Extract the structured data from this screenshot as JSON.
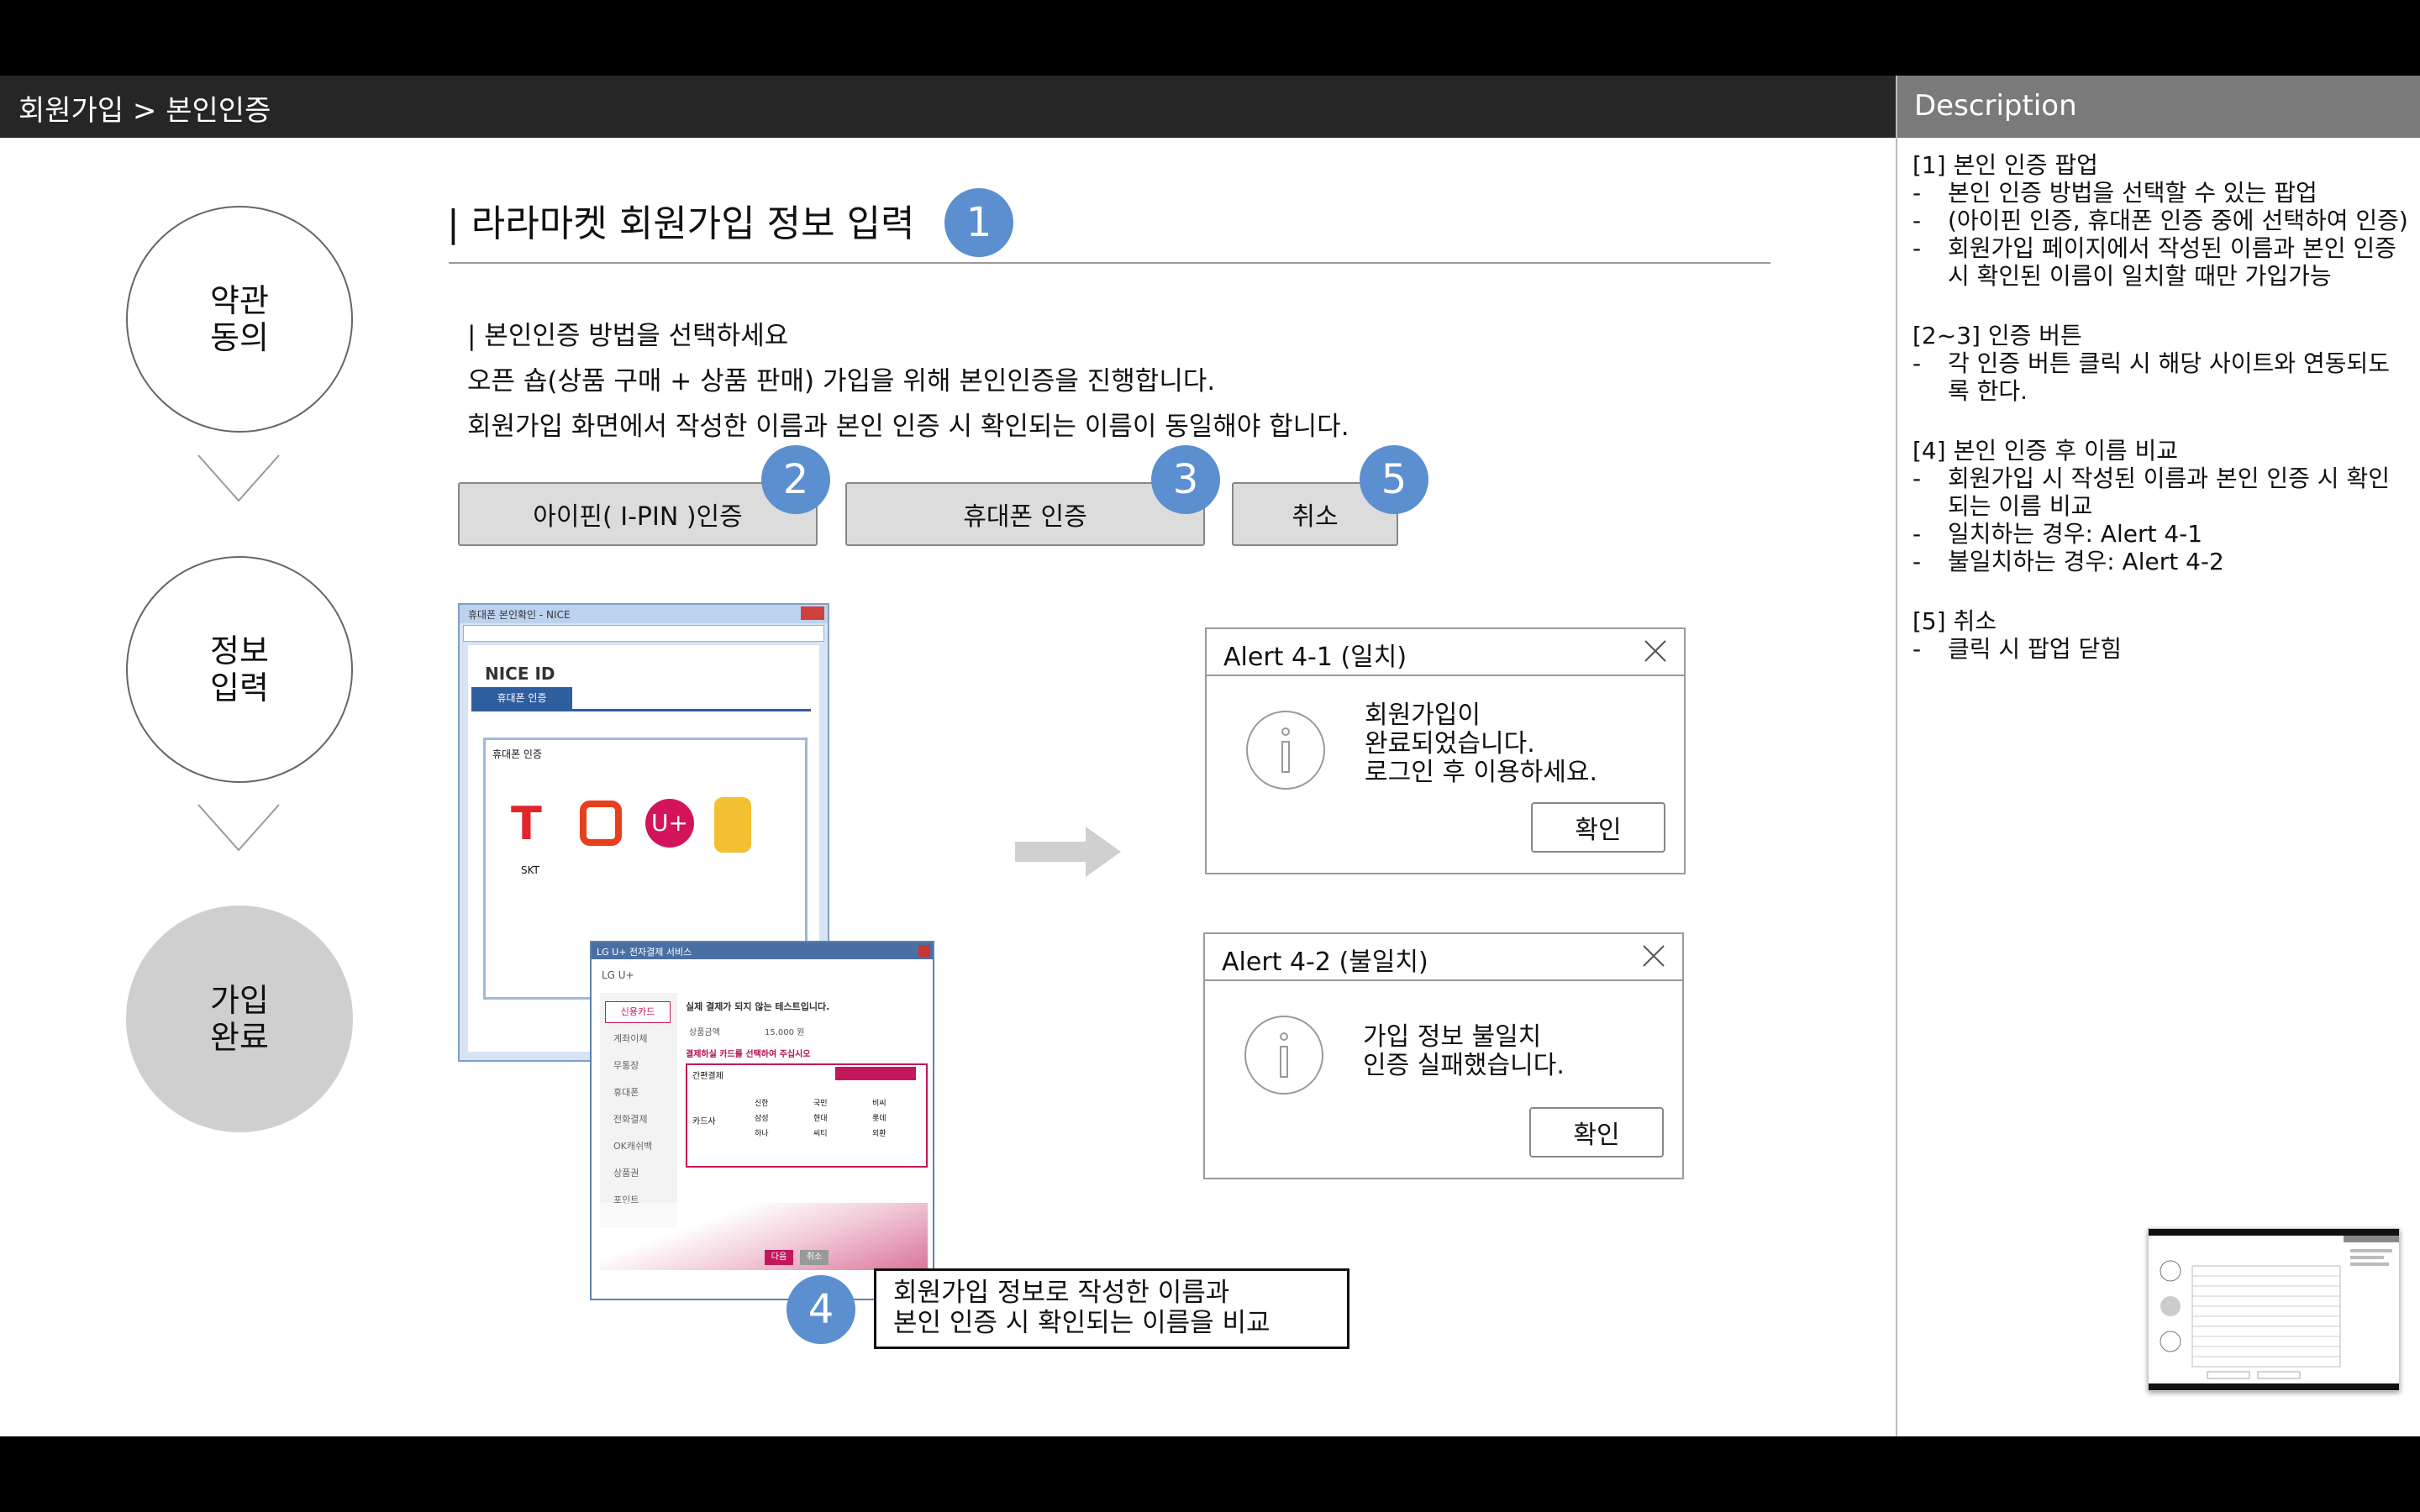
{
  "header": {
    "breadcrumb": "회원가입 > 본인인증"
  },
  "description": {
    "title": "Description",
    "sections": [
      {
        "heading": "[1] 본인 인증 팝업",
        "items": [
          "본인 인증 방법을 선택할 수 있는 팝업",
          "(아이핀 인증, 휴대폰 인증 중에 선택하여 인증)",
          "회원가입 페이지에서 작성된 이름과 본인 인증 시 확인된 이름이 일치할 때만 가입가능"
        ]
      },
      {
        "heading": "[2~3] 인증 버튼",
        "items": [
          "각 인증 버튼 클릭 시 해당 사이트와 연동되도록 한다."
        ]
      },
      {
        "heading": "[4] 본인 인증 후 이름 비교",
        "items": [
          "회원가입 시 작성된 이름과 본인 인증 시 확인되는 이름 비교",
          "일치하는 경우: Alert 4-1",
          "불일치하는 경우: Alert 4-2"
        ]
      },
      {
        "heading": "[5] 취소",
        "items": [
          "클릭 시 팝업 닫힘"
        ]
      }
    ]
  },
  "steps": [
    {
      "line1": "약관",
      "line2": "동의"
    },
    {
      "line1": "정보",
      "line2": "입력"
    },
    {
      "line1": "가입",
      "line2": "완료"
    }
  ],
  "main": {
    "title": "| 라라마켓 회원가입 정보 입력",
    "title_badge": "1",
    "subheading": "| 본인인증 방법을 선택하세요",
    "para1": "오픈 숍(상품 구매 + 상품 판매) 가입을 위해 본인인증을 진행합니다.",
    "para2": "회원가입 화면에서 작성한 이름과 본인 인증 시 확인되는 이름이 동일해야 합니다."
  },
  "buttons": {
    "ipin": {
      "label": "아이핀( I-PIN )인증",
      "badge": "2"
    },
    "phone": {
      "label": "휴대폰 인증",
      "badge": "3"
    },
    "cancel": {
      "label": "취소",
      "badge": "5"
    }
  },
  "popup_screens": {
    "nice": {
      "window_title": "휴대폰 본인확인 - NICE",
      "logo": "NICE ID",
      "tab": "휴대폰 인증",
      "carrier_label": "SKT",
      "notice": "휴대폰 인증"
    },
    "lgu": {
      "window_title": "LG U+ 전자결제 서비스",
      "brand": "LG U+",
      "menu": [
        "신용카드",
        "계좌이체",
        "무통장",
        "휴대폰",
        "전화결제",
        "OK캐쉬백",
        "상품권",
        "포인트"
      ],
      "heading": "실제 결제가 되지 않는 테스트입니다.",
      "amount_label": "상품금액",
      "amount": "15,000 원",
      "select_label": "결제하실 카드를 선택하여 주십시오",
      "pay_type": "간편결제",
      "card_label": "카드사",
      "cards": [
        "신한",
        "국민",
        "비씨",
        "삼성",
        "현대",
        "롯데",
        "하나",
        "씨티",
        "외환"
      ],
      "btn_ok": "다음",
      "btn_cancel": "취소"
    }
  },
  "alerts": {
    "match": {
      "title": "Alert 4-1 (일치)",
      "line1": "회원가입이",
      "line2": "완료되었습니다.",
      "line3": "로그인 후 이용하세요.",
      "ok": "확인"
    },
    "mismatch": {
      "title": "Alert 4-2 (불일치)",
      "line1": "가입 정보 불일치",
      "line2": "인증 실패했습니다.",
      "ok": "확인"
    }
  },
  "note": {
    "badge": "4",
    "line1": "회원가입 정보로 작성한 이름과",
    "line2": "본인 인증 시 확인되는 이름을 비교"
  },
  "colors": {
    "badge": "#5b8fcf",
    "topbar": "#262626",
    "desc_header": "#7a7a7a",
    "step_done": "#d0cfd0"
  }
}
